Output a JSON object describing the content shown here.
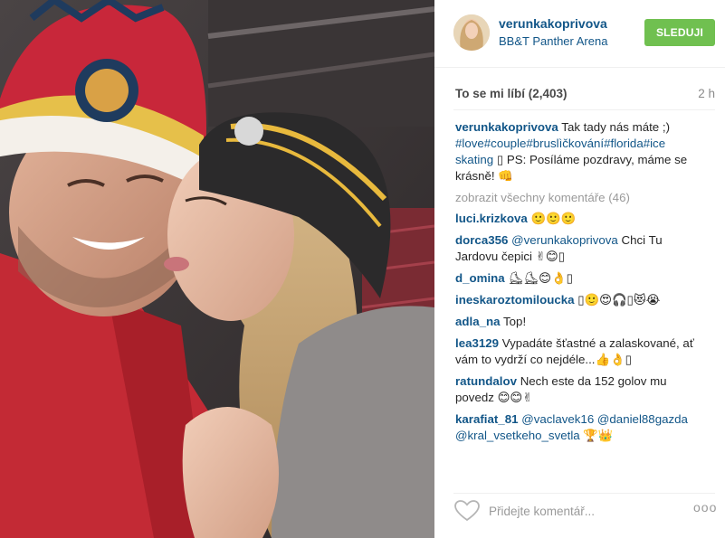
{
  "post": {
    "username": "verunkakoprivova",
    "location": "BB&T Panther Arena",
    "follow_label": "SLEDUJI",
    "likes_label": "To se mi líbí (2,403)",
    "time_ago": "2 h",
    "caption": {
      "user": "verunkakoprivova",
      "text": "Tak tady nás máte ;)",
      "tags": "#love#couple#bruslìčkování#florida#ice skating",
      "text2": "▯ PS: Posíláme pozdravy, máme se krásně! 👊"
    },
    "view_all_label": "zobrazit všechny komentáře (46)",
    "comments": [
      {
        "user": "luci.krizkova",
        "mention": "",
        "text": "🙂🙂🙂"
      },
      {
        "user": "dorca356",
        "mention": "@verunkakoprivova",
        "text": "Chci Tu Jardovu čepici ✌😊▯"
      },
      {
        "user": "d_omina",
        "mention": "",
        "text": "⛸⛸😊👌▯"
      },
      {
        "user": "ineskaroztomiloucka",
        "mention": "",
        "text": "▯🙂😍🎧▯😻😭"
      },
      {
        "user": "adla_na",
        "mention": "",
        "text": "Top!"
      },
      {
        "user": "lea3129",
        "mention": "",
        "text": "Vypadáte šťastné a zalaskované, ať vám to vydrží co nejdéle...👍👌▯"
      },
      {
        "user": "ratundalov",
        "mention": "",
        "text": "Nech este da 152 golov mu povedz 😊😊✌"
      },
      {
        "user": "karafiat_81",
        "mention": "@vaclavek16 @daniel88gazda @kral_vsetkeho_svetla",
        "text": "🏆👑"
      }
    ],
    "comment_placeholder": "Přidejte komentář...",
    "more_label": "ooo"
  },
  "icons": {
    "heart": "heart-icon",
    "more": "more-options-icon"
  },
  "colors": {
    "link": "#125688",
    "follow_button": "#70c050",
    "muted": "#9a9a9a"
  }
}
